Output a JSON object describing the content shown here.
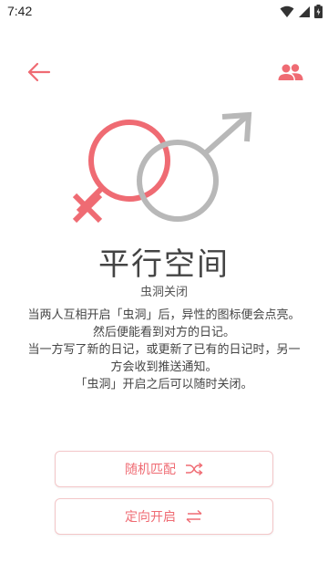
{
  "status_bar": {
    "time": "7:42",
    "icons": [
      "wifi-icon",
      "signal-icon",
      "battery-icon"
    ]
  },
  "header": {
    "back_icon": "arrow-left-icon",
    "people_icon": "people-icon"
  },
  "emblem": {
    "icon": "gender-symbols-icon",
    "female_color": "#ef6b73",
    "male_color": "#b8b8b8"
  },
  "title": "平行空间",
  "subtitle": "虫洞关闭",
  "description": {
    "line1": "当两人互相开启「虫洞」后，异性的图标便会点亮。然后便能看到对方的日记。",
    "line2": "当一方写了新的日记，或更新了已有的日记时，另一方会收到推送通知。",
    "line3": "「虫洞」开启之后可以随时关闭。"
  },
  "buttons": {
    "random_match": {
      "label": "随机匹配",
      "icon": "shuffle-icon"
    },
    "directed_open": {
      "label": "定向开启",
      "icon": "swap-arrows-icon"
    }
  },
  "colors": {
    "accent": "#ef6b73",
    "border": "#f3c6c8"
  }
}
